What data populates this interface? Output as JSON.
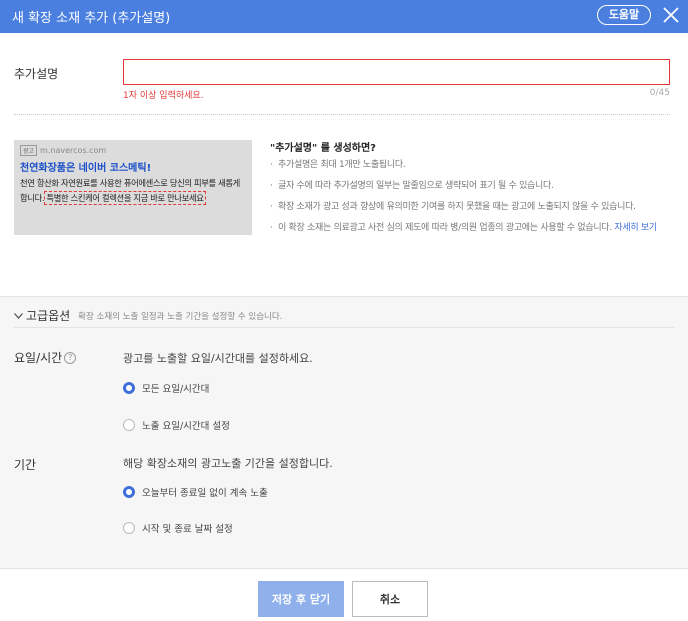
{
  "header": {
    "title": "새 확장 소재 추가 (추가설명)",
    "help_label": "도움말",
    "close_icon": "close-icon"
  },
  "form": {
    "field_label": "추가설명",
    "input_value": "",
    "error_text": "1자 이상 입력하세요.",
    "counter": "0/45"
  },
  "preview": {
    "badge": "광고",
    "url": "m.navercos.com",
    "title": "천연화장품은 네이버 코스메틱!",
    "desc_part1": "천연 항산화 자연원료를 사용한 퓨어에센스로 당신의 피부를 새롭게 합니다.",
    "desc_highlight": "특별한 스킨케어 컬렉션을 지금 바로 만나보세요"
  },
  "info": {
    "title": "\"추가설명\" 를 생성하면?",
    "items": [
      "추가설명은 최대 1개만 노출됩니다.",
      "글자 수에 따라 추가설명의 일부는 말줄임으로 생략되어 표기 될 수 있습니다.",
      "확장 소재가 광고 성과 향상에 유의미한 기여를 하지 못했을 때는 광고에 노출되지 않을 수 있습니다.",
      "이 확장 소재는 의료광고 사전 심의 제도에 따라 병/의원 업종의 광고에는 사용할 수 없습니다."
    ],
    "link": "자세히 보기"
  },
  "advanced": {
    "title": "고급옵션",
    "subtitle": "확장 소재의 노출 일정과 노출 기간을 설정할 수 있습니다.",
    "schedule": {
      "label": "요일/시간",
      "help_icon": "?",
      "desc": "광고를 노출할 요일/시간대를 설정하세요.",
      "options": [
        "모든 요일/시간대",
        "노출 요일/시간대 설정"
      ],
      "selected": 0
    },
    "period": {
      "label": "기간",
      "desc": "해당 확장소재의 광고노출 기간을 설정합니다.",
      "options": [
        "오늘부터 종료일 없이 계속 노출",
        "시작 및 종료 날짜 설정"
      ],
      "selected": 0
    }
  },
  "footer": {
    "save_label": "저장 후 닫기",
    "cancel_label": "취소"
  },
  "colors": {
    "accent": "#4a7fe0",
    "error": "#e23838",
    "link": "#3e6fd8"
  }
}
